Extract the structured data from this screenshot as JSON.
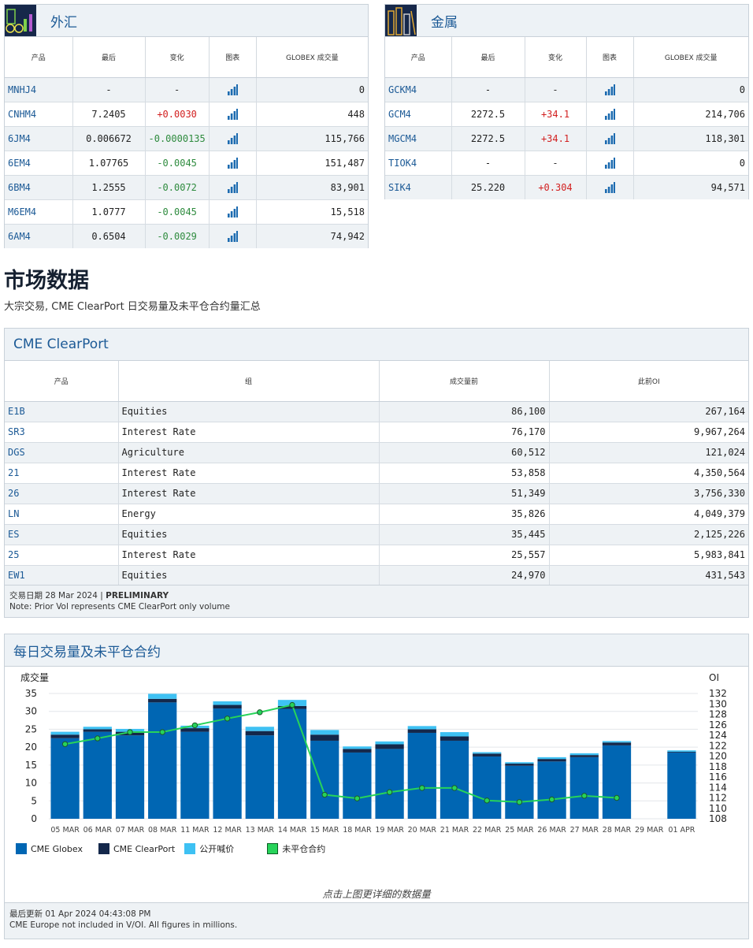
{
  "fx": {
    "title": "外汇",
    "headers": [
      "产品",
      "最后",
      "变化",
      "图表",
      "GLOBEX 成交量"
    ],
    "rows": [
      {
        "code": "MNHJ4",
        "last": "-",
        "change": "-",
        "dir": "flat",
        "volume": "0"
      },
      {
        "code": "CNHM4",
        "last": "7.2405",
        "change": "+0.0030",
        "dir": "up",
        "volume": "448"
      },
      {
        "code": "6JM4",
        "last": "0.006672",
        "change": "-0.0000135",
        "dir": "down",
        "volume": "115,766"
      },
      {
        "code": "6EM4",
        "last": "1.07765",
        "change": "-0.0045",
        "dir": "down",
        "volume": "151,487"
      },
      {
        "code": "6BM4",
        "last": "1.2555",
        "change": "-0.0072",
        "dir": "down",
        "volume": "83,901"
      },
      {
        "code": "M6EM4",
        "last": "1.0777",
        "change": "-0.0045",
        "dir": "down",
        "volume": "15,518"
      },
      {
        "code": "6AM4",
        "last": "0.6504",
        "change": "-0.0029",
        "dir": "down",
        "volume": "74,942"
      }
    ]
  },
  "metals": {
    "title": "金属",
    "headers": [
      "产品",
      "最后",
      "变化",
      "图表",
      "GLOBEX 成交量"
    ],
    "rows": [
      {
        "code": "GCKM4",
        "last": "-",
        "change": "-",
        "dir": "flat",
        "volume": "0"
      },
      {
        "code": "GCM4",
        "last": "2272.5",
        "change": "+34.1",
        "dir": "up",
        "volume": "214,706"
      },
      {
        "code": "MGCM4",
        "last": "2272.5",
        "change": "+34.1",
        "dir": "up",
        "volume": "118,301"
      },
      {
        "code": "TIOK4",
        "last": "-",
        "change": "-",
        "dir": "flat",
        "volume": "0"
      },
      {
        "code": "SIK4",
        "last": "25.220",
        "change": "+0.304",
        "dir": "up",
        "volume": "94,571"
      }
    ]
  },
  "market": {
    "title": "市场数据",
    "subtitle": "大宗交易, CME ClearPort 日交易量及未平仓合约量汇总"
  },
  "clearport": {
    "title": "CME ClearPort",
    "headers": [
      "产品",
      "组",
      "成交量前",
      "此前OI"
    ],
    "rows": [
      {
        "code": "E1B",
        "group": "Equities",
        "volume": "86,100",
        "oi": "267,164"
      },
      {
        "code": "SR3",
        "group": "Interest Rate",
        "volume": "76,170",
        "oi": "9,967,264"
      },
      {
        "code": "DGS",
        "group": "Agriculture",
        "volume": "60,512",
        "oi": "121,024"
      },
      {
        "code": "21",
        "group": "Interest Rate",
        "volume": "53,858",
        "oi": "4,350,564"
      },
      {
        "code": "26",
        "group": "Interest Rate",
        "volume": "51,349",
        "oi": "3,756,330"
      },
      {
        "code": "LN",
        "group": "Energy",
        "volume": "35,826",
        "oi": "4,049,379"
      },
      {
        "code": "ES",
        "group": "Equities",
        "volume": "35,445",
        "oi": "2,125,226"
      },
      {
        "code": "25",
        "group": "Interest Rate",
        "volume": "25,557",
        "oi": "5,983,841"
      },
      {
        "code": "EW1",
        "group": "Equities",
        "volume": "24,970",
        "oi": "431,543"
      }
    ],
    "footer_date_label": "交易日期 28 Mar 2024 | ",
    "footer_status": "PRELIMINARY",
    "footer_note": "Note: Prior Vol represents CME ClearPort only volume"
  },
  "daily": {
    "title": "每日交易量及未平仓合约",
    "click_note": "点击上图更详细的数据量",
    "footer_updated": "最后更新 01 Apr 2024 04:43:08 PM",
    "footer_note": "CME Europe not included in V/OI. All figures in millions."
  },
  "colors": {
    "globex": "#0066b3",
    "clearport": "#14284b",
    "outcry": "#3ec1f3",
    "oi": "#27d35a",
    "link": "#1c5a96",
    "up": "#d21f1f",
    "down": "#2e8b3e"
  },
  "chart_data": {
    "type": "bar",
    "ylabel": "成交量",
    "y2label": "OI",
    "ylim": [
      0,
      35
    ],
    "y2lim": [
      108,
      132
    ],
    "yticks": [
      0,
      5,
      10,
      15,
      20,
      25,
      30,
      35
    ],
    "y2ticks": [
      108,
      110,
      112,
      114,
      116,
      118,
      120,
      122,
      124,
      126,
      128,
      130,
      132
    ],
    "categories": [
      "05 MAR",
      "06 MAR",
      "07 MAR",
      "08 MAR",
      "11 MAR",
      "12 MAR",
      "13 MAR",
      "14 MAR",
      "15 MAR",
      "18 MAR",
      "19 MAR",
      "20 MAR",
      "21 MAR",
      "22 MAR",
      "25 MAR",
      "26 MAR",
      "27 MAR",
      "28 MAR",
      "29 MAR",
      "01 APR"
    ],
    "legend": [
      "CME Globex",
      "CME ClearPort",
      "公开喊价",
      "未平仓合约"
    ],
    "series": [
      {
        "name": "CME Globex",
        "values": [
          22.5,
          24.3,
          23.3,
          32.5,
          24.3,
          30.8,
          23.3,
          30.7,
          21.8,
          18.5,
          19.5,
          24.0,
          21.8,
          17.4,
          14.8,
          16.0,
          17.2,
          20.5,
          0,
          18.5
        ]
      },
      {
        "name": "CME ClearPort",
        "values": [
          1.0,
          0.7,
          1.0,
          1.0,
          1.0,
          1.0,
          1.2,
          0.8,
          1.7,
          1.0,
          1.3,
          1.0,
          1.2,
          0.8,
          0.6,
          0.7,
          0.6,
          0.8,
          0,
          0.2
        ]
      },
      {
        "name": "公开喊价",
        "values": [
          0.8,
          0.7,
          0.8,
          1.4,
          0.7,
          1.0,
          1.2,
          1.7,
          1.3,
          0.7,
          0.8,
          0.9,
          1.2,
          0.4,
          0.4,
          0.5,
          0.5,
          0.4,
          0,
          0.4
        ]
      },
      {
        "name": "未平仓合约",
        "values": [
          122.3,
          123.4,
          124.6,
          124.6,
          125.9,
          127.2,
          128.4,
          129.8,
          112.6,
          111.9,
          113.1,
          113.9,
          113.9,
          111.5,
          111.2,
          111.7,
          112.4,
          112.0,
          null,
          null
        ]
      }
    ]
  }
}
